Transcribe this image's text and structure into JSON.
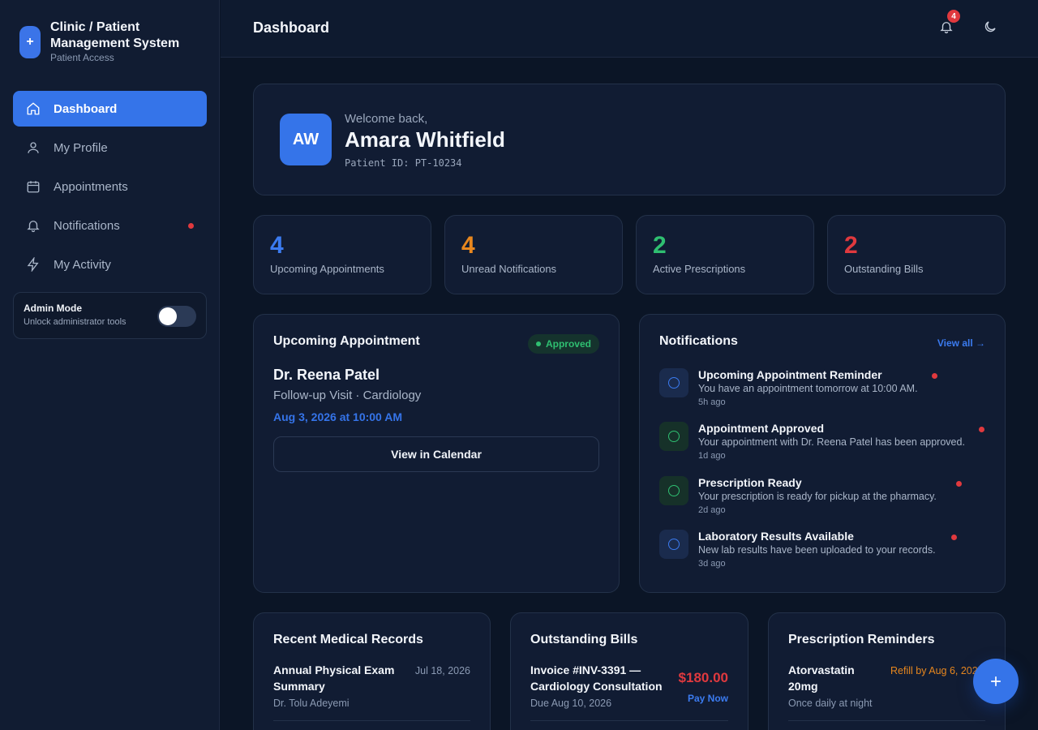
{
  "sidebar": {
    "logo_glyph": "+",
    "title": "Clinic / Patient Management System",
    "subtitle": "Patient Access",
    "items": [
      {
        "label": "Dashboard",
        "icon": "home-icon",
        "active": true
      },
      {
        "label": "My Profile",
        "icon": "user-icon"
      },
      {
        "label": "Appointments",
        "icon": "calendar-icon"
      },
      {
        "label": "Notifications",
        "icon": "bell-icon",
        "dot": true
      },
      {
        "label": "My Activity",
        "icon": "bolt-icon"
      }
    ],
    "admin": {
      "title": "Admin Mode",
      "subtitle": "Unlock administrator tools",
      "enabled": false
    }
  },
  "header": {
    "title": "Dashboard",
    "notification_count": "4"
  },
  "welcome": {
    "initials": "AW",
    "greeting": "Welcome back,",
    "name": "Amara Whitfield",
    "patient_id": "Patient ID: PT-10234"
  },
  "stats": [
    {
      "value": "4",
      "label": "Upcoming Appointments",
      "color": "#3b7bf0"
    },
    {
      "value": "4",
      "label": "Unread Notifications",
      "color": "#e8871e"
    },
    {
      "value": "2",
      "label": "Active Prescriptions",
      "color": "#2fbf71"
    },
    {
      "value": "2",
      "label": "Outstanding Bills",
      "color": "#e0393e"
    }
  ],
  "appointment": {
    "title": "Upcoming Appointment",
    "status": "Approved",
    "doctor": "Dr. Reena Patel",
    "visit": "Follow-up Visit · Cardiology",
    "date": "Aug 3, 2026 at 10:00 AM",
    "button": "View in Calendar"
  },
  "notifications": {
    "title": "Notifications",
    "view_all": "View all →",
    "items": [
      {
        "title": "Upcoming Appointment Reminder",
        "body": "You have an appointment tomorrow at 10:00 AM.",
        "time": "5h ago",
        "tone": "blue"
      },
      {
        "title": "Appointment Approved",
        "body": "Your appointment with Dr. Reena Patel has been approved.",
        "time": "1d ago",
        "tone": "green"
      },
      {
        "title": "Prescription Ready",
        "body": "Your prescription is ready for pickup at the pharmacy.",
        "time": "2d ago",
        "tone": "green"
      },
      {
        "title": "Laboratory Results Available",
        "body": "New lab results have been uploaded to your records.",
        "time": "3d ago",
        "tone": "blue"
      }
    ]
  },
  "records": {
    "title": "Recent Medical Records",
    "item_title": "Annual Physical Exam Summary",
    "item_sub": "Dr. Tolu Adeyemi",
    "item_date": "Jul 18, 2026"
  },
  "bills": {
    "title": "Outstanding Bills",
    "item_title": "Invoice #INV-3391 — Cardiology Consultation",
    "item_sub": "Due Aug 10, 2026",
    "amount": "$180.00",
    "action": "Pay Now"
  },
  "prescriptions": {
    "title": "Prescription Reminders",
    "item_title": "Atorvastatin 20mg",
    "item_sub": "Once daily at night",
    "refill": "Refill by Aug 6, 2026"
  },
  "colors": {
    "accent": "#3574e9",
    "danger": "#e0393e",
    "success": "#2fbf71",
    "warning": "#e8871e"
  }
}
